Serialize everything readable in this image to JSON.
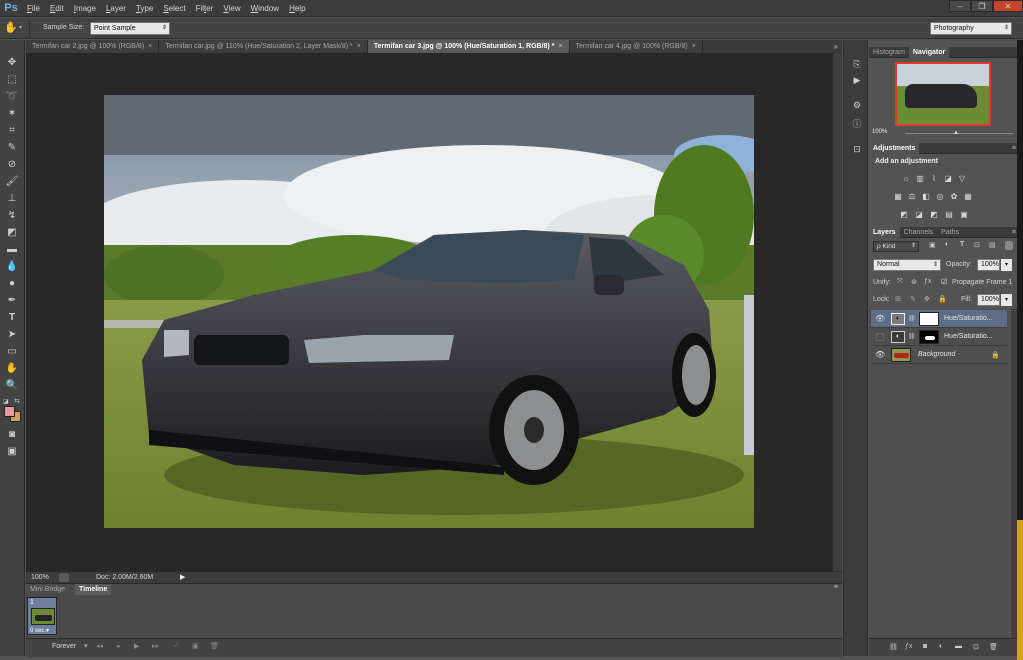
{
  "app": {
    "logo": "Ps"
  },
  "menu": [
    {
      "pre": "",
      "u": "F",
      "post": "ile"
    },
    {
      "pre": "",
      "u": "E",
      "post": "dit"
    },
    {
      "pre": "",
      "u": "I",
      "post": "mage"
    },
    {
      "pre": "",
      "u": "L",
      "post": "ayer"
    },
    {
      "pre": "",
      "u": "T",
      "post": "ype"
    },
    {
      "pre": "",
      "u": "S",
      "post": "elect"
    },
    {
      "pre": "Fil",
      "u": "t",
      "post": "er"
    },
    {
      "pre": "",
      "u": "V",
      "post": "iew"
    },
    {
      "pre": "",
      "u": "W",
      "post": "indow"
    },
    {
      "pre": "",
      "u": "H",
      "post": "elp"
    }
  ],
  "window_buttons": {
    "minimize": "–",
    "restore": "❐",
    "close": "✕"
  },
  "options": {
    "sample_size_label": "Sample Size:",
    "sample_size_value": "Point Sample",
    "workspace": "Photography"
  },
  "tabs": [
    {
      "label": "Termifan car 2.jpg @ 100% (RGB/8)",
      "close": "×",
      "active": false
    },
    {
      "label": "Termifan car.jpg @ 110% (Hue/Saturation 2, Layer Mask/8) *",
      "close": "×",
      "active": false
    },
    {
      "label": "Termifan car 3.jpg @ 100% (Hue/Saturation 1, RGB/8) *",
      "close": "×",
      "active": true
    },
    {
      "label": "Termifan car 4.jpg @ 100% (RGB/8)",
      "close": "×",
      "active": false
    }
  ],
  "tab_overflow": "»",
  "status": {
    "zoom": "100%",
    "doc": "Doc: 2.00M/2.60M"
  },
  "timeline": {
    "tabs": [
      "Mini Bridge",
      "Timeline"
    ],
    "frame_number": "1",
    "frame_delay": "0 sec.▾",
    "loop": "Forever"
  },
  "navigator": {
    "tabs": [
      "Histogram",
      "Navigator"
    ],
    "zoom": "100%"
  },
  "adjustments": {
    "tab": "Adjustments",
    "heading": "Add an adjustment"
  },
  "layers": {
    "tabs": [
      "Layers",
      "Channels",
      "Paths"
    ],
    "filter_kind": "ρ Kind",
    "blend_mode": "Normal",
    "opacity_label": "Opacity:",
    "opacity_value": "100%",
    "unify_label": "Unify:",
    "propagate_label": "Propagate Frame 1",
    "lock_label": "Lock:",
    "fill_label": "Fill:",
    "fill_value": "100%",
    "items": [
      {
        "name": "Hue/Saturatio...",
        "selected": true
      },
      {
        "name": "Hue/Saturatio...",
        "selected": false
      },
      {
        "name": "Background",
        "selected": false
      }
    ]
  }
}
